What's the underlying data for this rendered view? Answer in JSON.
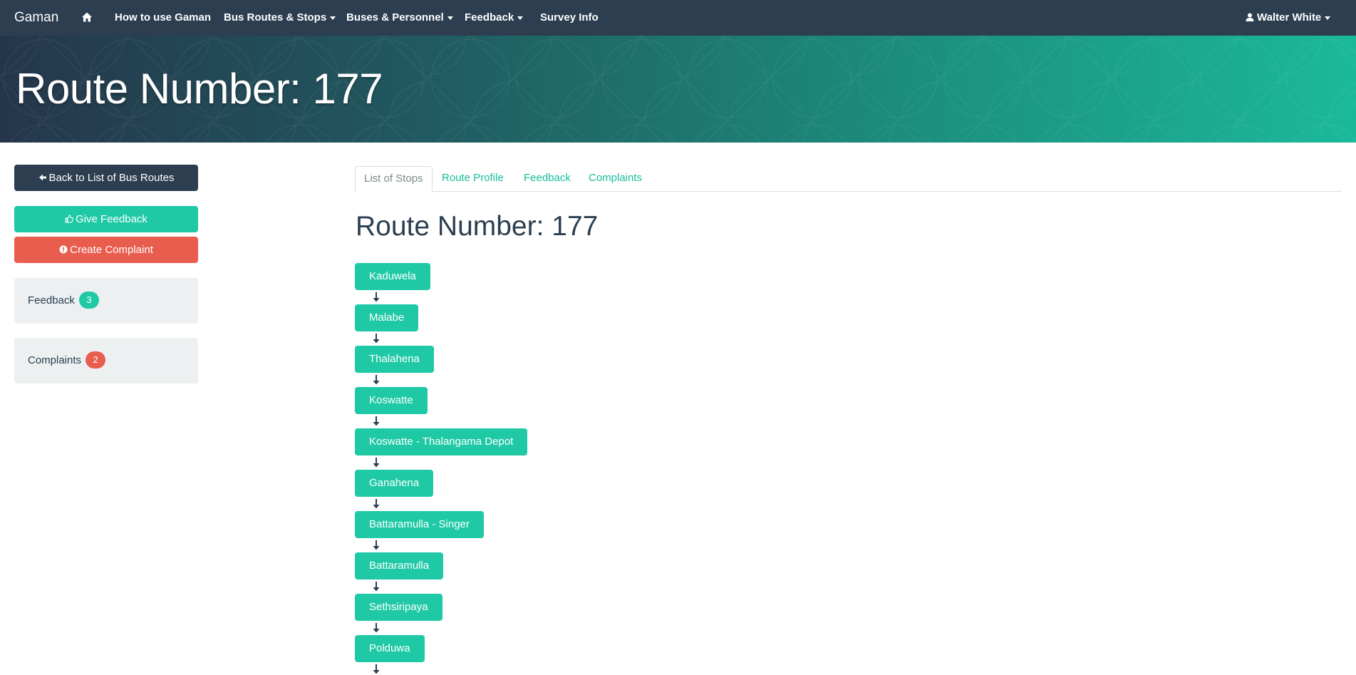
{
  "navbar": {
    "brand": "Gaman",
    "home_icon": "home-icon",
    "links": [
      {
        "label": "How to use Gaman",
        "dropdown": false
      },
      {
        "label": "Bus Routes & Stops",
        "dropdown": true
      },
      {
        "label": "Buses & Personnel",
        "dropdown": true
      },
      {
        "label": "Feedback",
        "dropdown": true
      },
      {
        "label": "Survey Info",
        "dropdown": false
      }
    ],
    "user": {
      "label": "Walter White",
      "icon": "user-icon",
      "dropdown": true
    }
  },
  "banner": {
    "title": "Route Number: 177"
  },
  "sidebar": {
    "back_button": {
      "label": "Back to List of Bus Routes",
      "icon": "arrow-left-icon"
    },
    "give_feedback_button": {
      "label": "Give Feedback",
      "icon": "thumbs-up-icon"
    },
    "create_complaint_button": {
      "label": "Create Complaint",
      "icon": "exclamation-circle-icon"
    },
    "feedback_summary": {
      "label": "Feedback",
      "count": "3"
    },
    "complaints_summary": {
      "label": "Complaints",
      "count": "2"
    }
  },
  "tabs": [
    {
      "label": "List of Stops",
      "active": true
    },
    {
      "label": "Route Profile",
      "active": false
    },
    {
      "label": "Feedback",
      "active": false
    },
    {
      "label": "Complaints",
      "active": false
    }
  ],
  "main": {
    "heading": "Route Number: 177",
    "stops": [
      "Kaduwela",
      "Malabe",
      "Thalahena",
      "Koswatte",
      "Koswatte - Thalangama Depot",
      "Ganahena",
      "Battaramulla - Singer",
      "Battaramulla",
      "Sethsiripaya",
      "Polduwa"
    ]
  },
  "colors": {
    "navbar": "#2c3e50",
    "primary": "#2c3e50",
    "success": "#1fc9a6",
    "danger": "#e95d4f",
    "link": "#18bc9c",
    "well": "#ecf0f1"
  }
}
